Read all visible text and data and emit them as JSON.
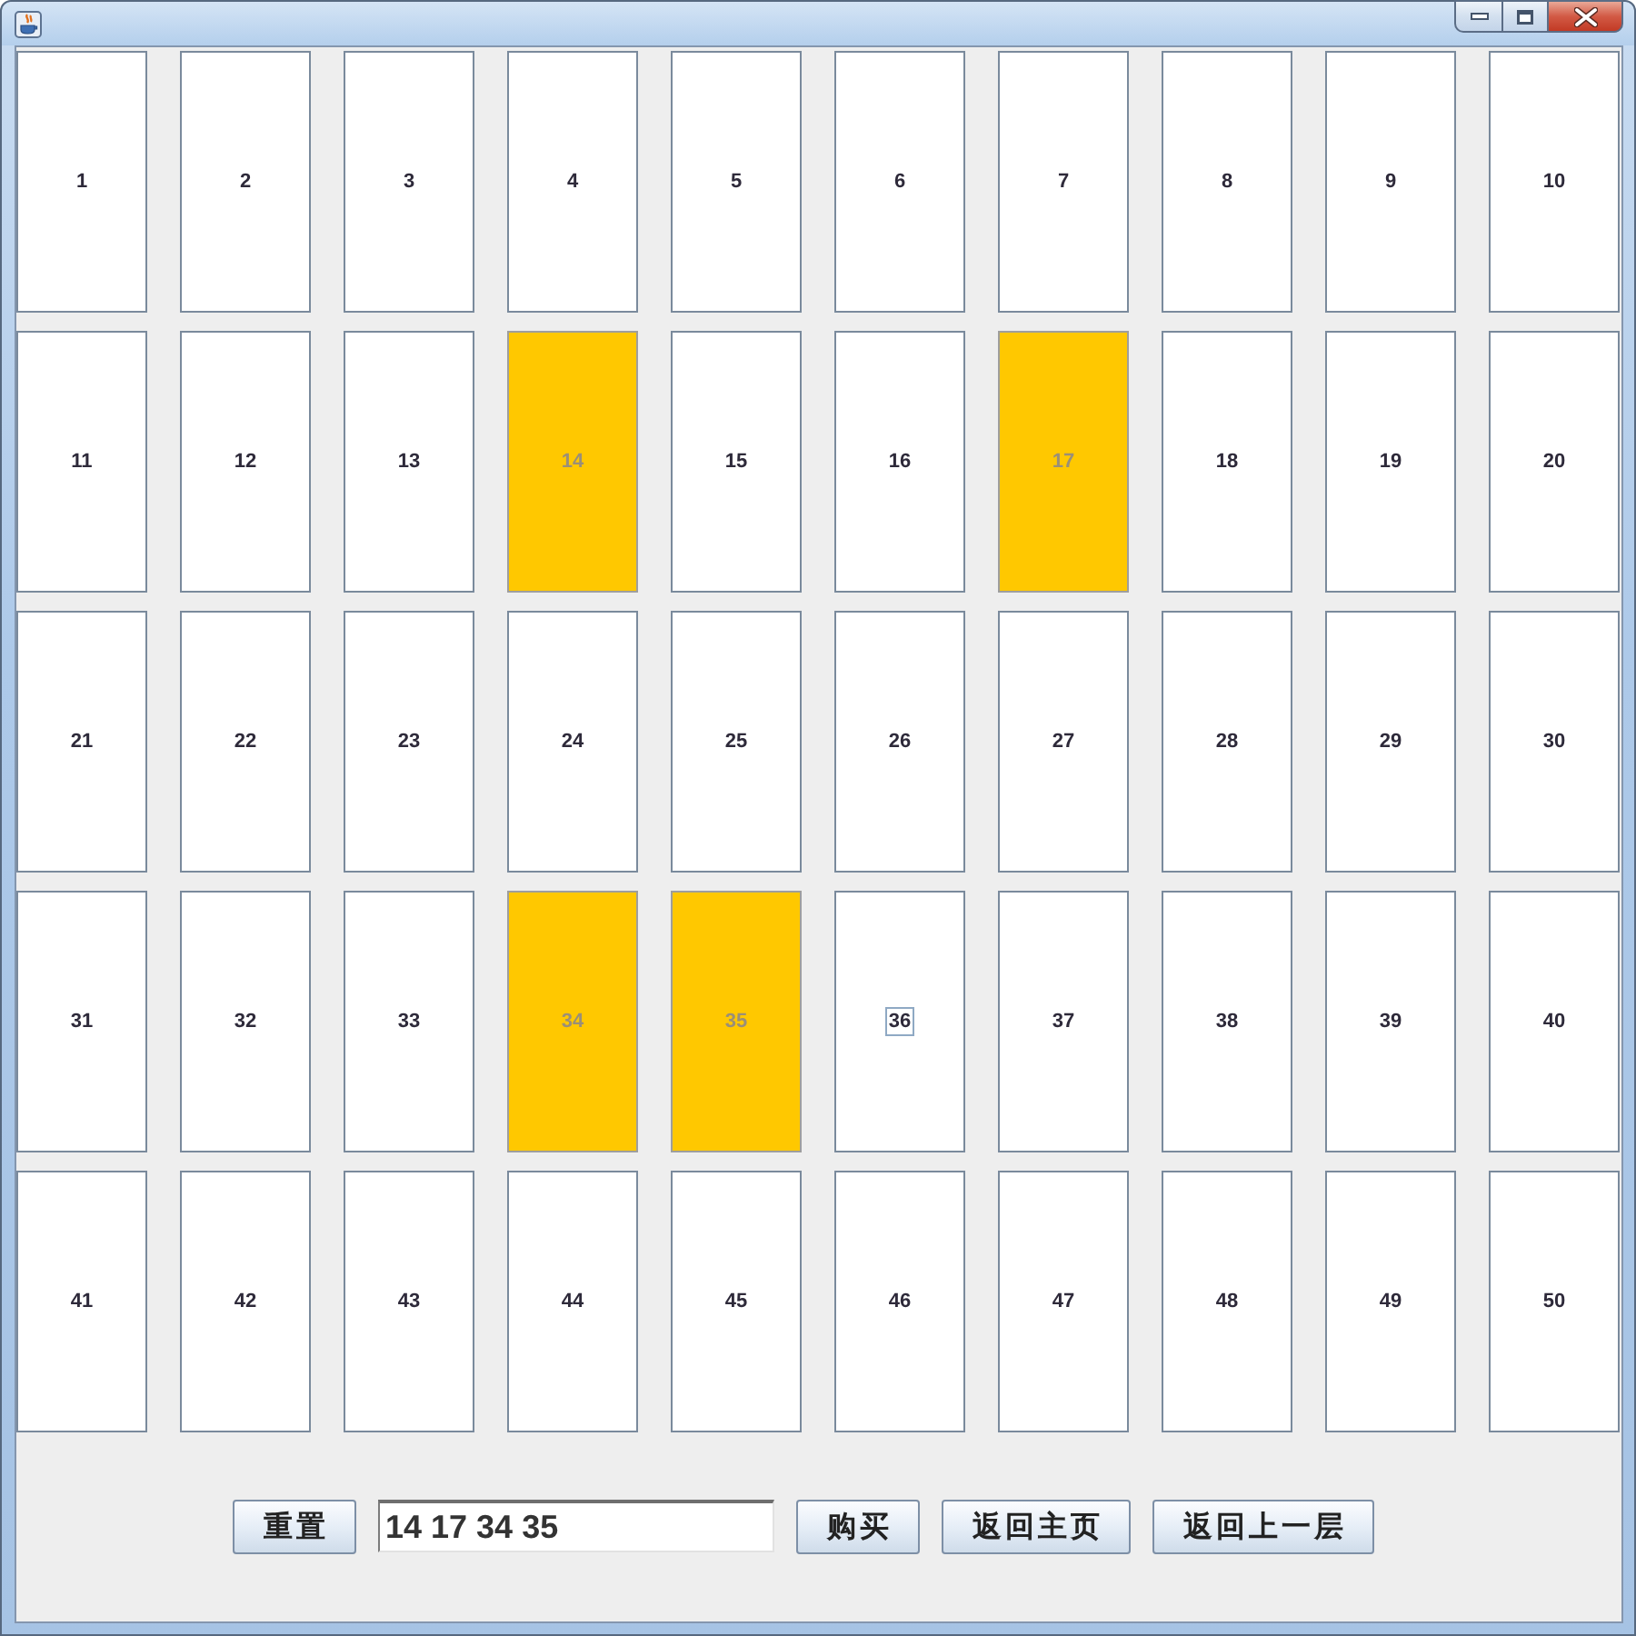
{
  "grid": {
    "buttons": [
      {
        "label": "1",
        "selected": false,
        "focused": false
      },
      {
        "label": "2",
        "selected": false,
        "focused": false
      },
      {
        "label": "3",
        "selected": false,
        "focused": false
      },
      {
        "label": "4",
        "selected": false,
        "focused": false
      },
      {
        "label": "5",
        "selected": false,
        "focused": false
      },
      {
        "label": "6",
        "selected": false,
        "focused": false
      },
      {
        "label": "7",
        "selected": false,
        "focused": false
      },
      {
        "label": "8",
        "selected": false,
        "focused": false
      },
      {
        "label": "9",
        "selected": false,
        "focused": false
      },
      {
        "label": "10",
        "selected": false,
        "focused": false
      },
      {
        "label": "11",
        "selected": false,
        "focused": false
      },
      {
        "label": "12",
        "selected": false,
        "focused": false
      },
      {
        "label": "13",
        "selected": false,
        "focused": false
      },
      {
        "label": "14",
        "selected": true,
        "focused": false
      },
      {
        "label": "15",
        "selected": false,
        "focused": false
      },
      {
        "label": "16",
        "selected": false,
        "focused": false
      },
      {
        "label": "17",
        "selected": true,
        "focused": false
      },
      {
        "label": "18",
        "selected": false,
        "focused": false
      },
      {
        "label": "19",
        "selected": false,
        "focused": false
      },
      {
        "label": "20",
        "selected": false,
        "focused": false
      },
      {
        "label": "21",
        "selected": false,
        "focused": false
      },
      {
        "label": "22",
        "selected": false,
        "focused": false
      },
      {
        "label": "23",
        "selected": false,
        "focused": false
      },
      {
        "label": "24",
        "selected": false,
        "focused": false
      },
      {
        "label": "25",
        "selected": false,
        "focused": false
      },
      {
        "label": "26",
        "selected": false,
        "focused": false
      },
      {
        "label": "27",
        "selected": false,
        "focused": false
      },
      {
        "label": "28",
        "selected": false,
        "focused": false
      },
      {
        "label": "29",
        "selected": false,
        "focused": false
      },
      {
        "label": "30",
        "selected": false,
        "focused": false
      },
      {
        "label": "31",
        "selected": false,
        "focused": false
      },
      {
        "label": "32",
        "selected": false,
        "focused": false
      },
      {
        "label": "33",
        "selected": false,
        "focused": false
      },
      {
        "label": "34",
        "selected": true,
        "focused": false
      },
      {
        "label": "35",
        "selected": true,
        "focused": false
      },
      {
        "label": "36",
        "selected": false,
        "focused": true
      },
      {
        "label": "37",
        "selected": false,
        "focused": false
      },
      {
        "label": "38",
        "selected": false,
        "focused": false
      },
      {
        "label": "39",
        "selected": false,
        "focused": false
      },
      {
        "label": "40",
        "selected": false,
        "focused": false
      },
      {
        "label": "41",
        "selected": false,
        "focused": false
      },
      {
        "label": "42",
        "selected": false,
        "focused": false
      },
      {
        "label": "43",
        "selected": false,
        "focused": false
      },
      {
        "label": "44",
        "selected": false,
        "focused": false
      },
      {
        "label": "45",
        "selected": false,
        "focused": false
      },
      {
        "label": "46",
        "selected": false,
        "focused": false
      },
      {
        "label": "47",
        "selected": false,
        "focused": false
      },
      {
        "label": "48",
        "selected": false,
        "focused": false
      },
      {
        "label": "49",
        "selected": false,
        "focused": false
      },
      {
        "label": "50",
        "selected": false,
        "focused": false
      }
    ]
  },
  "footer": {
    "controls": [
      {
        "kind": "button",
        "label": "重置"
      },
      {
        "kind": "field",
        "value": "14 17 34 35"
      },
      {
        "kind": "button",
        "label": "购买"
      },
      {
        "kind": "button",
        "label": "返回主页"
      },
      {
        "kind": "button",
        "label": "返回上一层"
      }
    ]
  }
}
